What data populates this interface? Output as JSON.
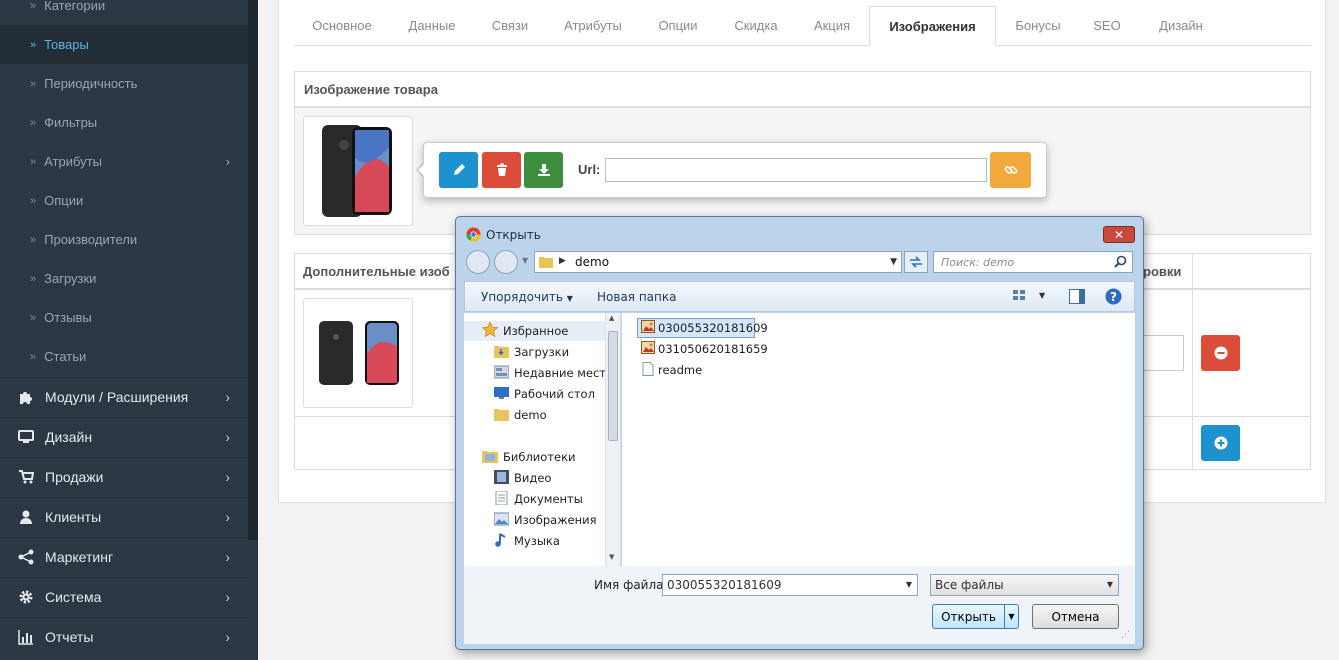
{
  "sidebar": {
    "sub_items": [
      {
        "label": "Категории",
        "chevron": false,
        "active": false
      },
      {
        "label": "Товары",
        "chevron": false,
        "active": true
      },
      {
        "label": "Периодичность",
        "chevron": false,
        "active": false
      },
      {
        "label": "Фильтры",
        "chevron": false,
        "active": false
      },
      {
        "label": "Атрибуты",
        "chevron": true,
        "active": false
      },
      {
        "label": "Опции",
        "chevron": false,
        "active": false
      },
      {
        "label": "Производители",
        "chevron": false,
        "active": false
      },
      {
        "label": "Загрузки",
        "chevron": false,
        "active": false
      },
      {
        "label": "Отзывы",
        "chevron": false,
        "active": false
      },
      {
        "label": "Статьи",
        "chevron": false,
        "active": false
      }
    ],
    "main_items": [
      {
        "label": "Модули / Расширения",
        "icon": "puzzle-icon"
      },
      {
        "label": "Дизайн",
        "icon": "monitor-icon"
      },
      {
        "label": "Продажи",
        "icon": "cart-icon"
      },
      {
        "label": "Клиенты",
        "icon": "user-icon"
      },
      {
        "label": "Маркетинг",
        "icon": "share-icon"
      },
      {
        "label": "Система",
        "icon": "gear-icon"
      },
      {
        "label": "Отчеты",
        "icon": "bar-chart-icon"
      }
    ]
  },
  "tabs": [
    {
      "label": "Основное"
    },
    {
      "label": "Данные"
    },
    {
      "label": "Связи"
    },
    {
      "label": "Атрибуты"
    },
    {
      "label": "Опции"
    },
    {
      "label": "Скидка"
    },
    {
      "label": "Акция"
    },
    {
      "label": "Изображения",
      "active": true
    },
    {
      "label": "Бонусы"
    },
    {
      "label": "SEO"
    },
    {
      "label": "Дизайн"
    }
  ],
  "image_section": {
    "header": "Изображение товара",
    "url_label": "Url:",
    "url_value": ""
  },
  "additional_section": {
    "header_left": "Дополнительные изоб",
    "header_right": "ровки"
  },
  "colors": {
    "primary": "#1e91cf",
    "danger": "#dd4b39",
    "success": "#3c8d3c",
    "warning": "#f2a93b",
    "sidebar_bg": "#2b3843"
  },
  "dialog": {
    "title": "Открыть",
    "path": "demo",
    "search_placeholder": "Поиск: demo",
    "organize": "Упорядочить",
    "new_folder": "Новая папка",
    "favorites": "Избранное",
    "nav": [
      "Загрузки",
      "Недавние места",
      "Рабочий стол",
      "demo"
    ],
    "libraries": "Библиотеки",
    "lib_items": [
      "Видео",
      "Документы",
      "Изображения",
      "Музыка"
    ],
    "files": [
      {
        "name": "030055320181609",
        "selected": true,
        "type": "image"
      },
      {
        "name": "031050620181659",
        "selected": false,
        "type": "image"
      },
      {
        "name": "readme",
        "selected": false,
        "type": "text"
      }
    ],
    "filename_label": "Имя файла:",
    "filename_value": "030055320181609",
    "filter": "Все файлы",
    "open_btn": "Открыть",
    "cancel_btn": "Отмена"
  }
}
